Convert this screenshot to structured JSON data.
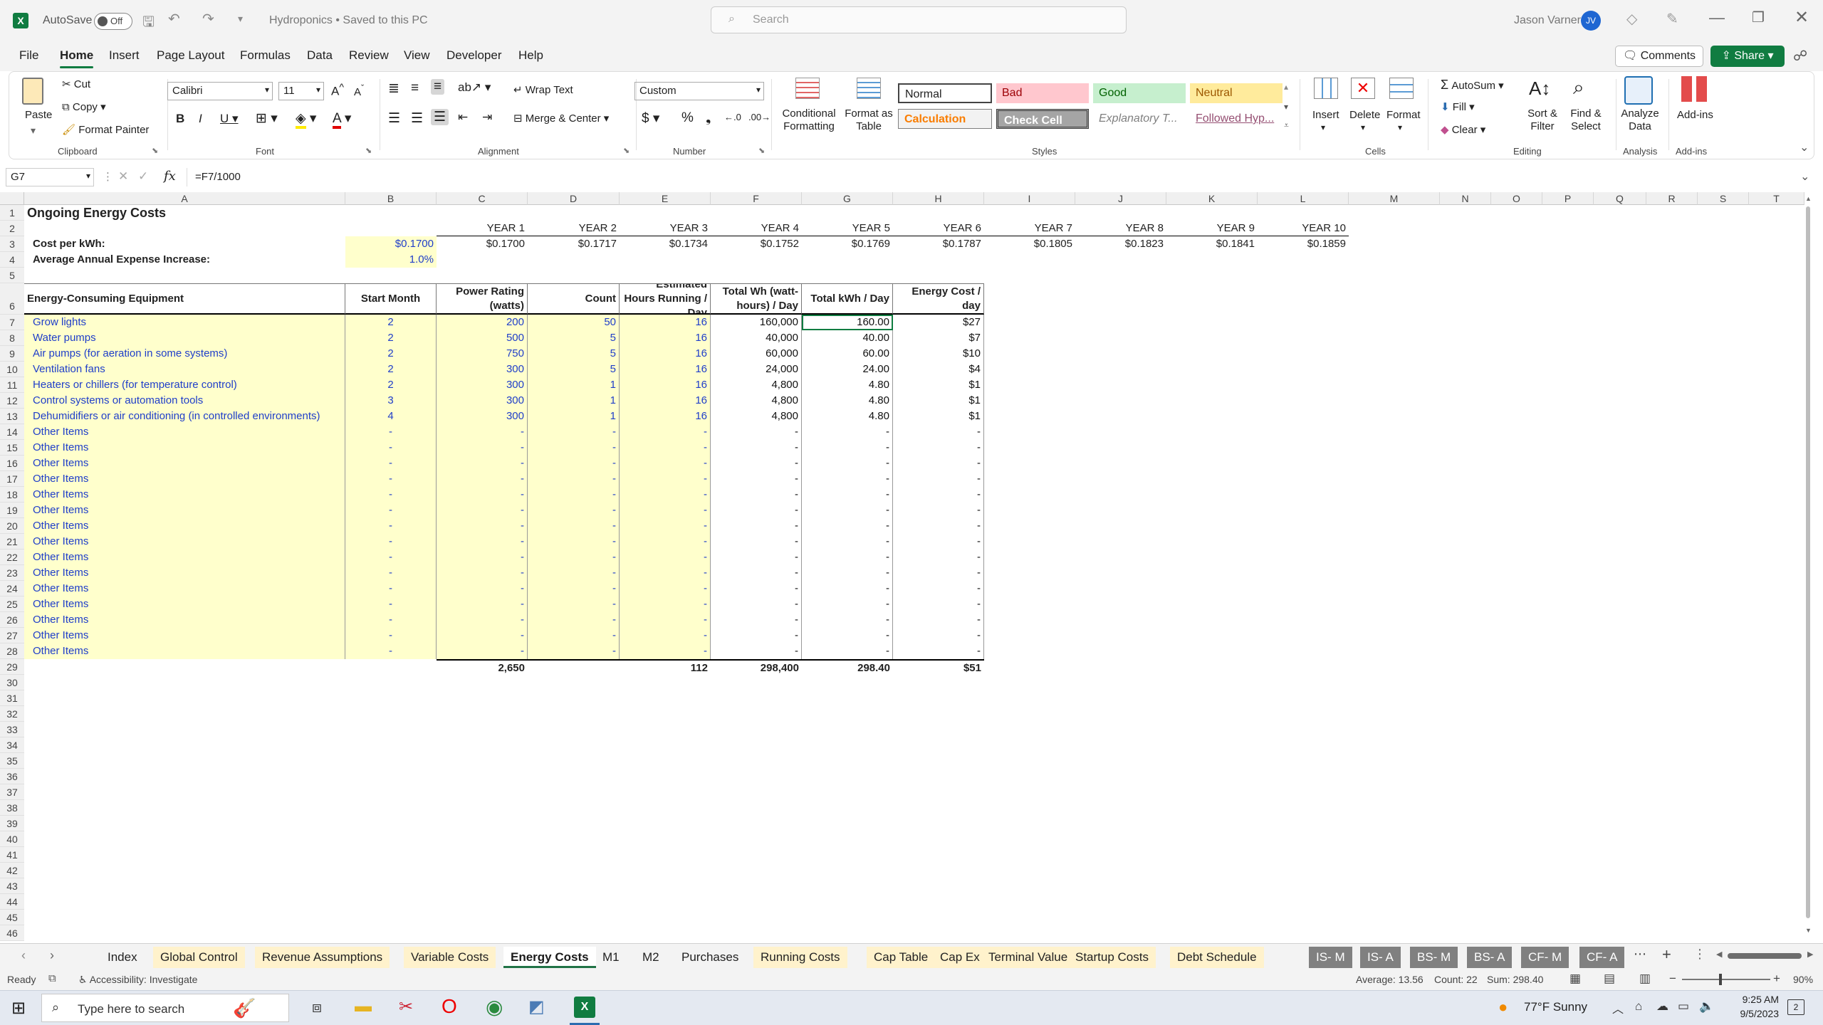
{
  "titlebar": {
    "autosave_label": "AutoSave",
    "autosave_state": "Off",
    "doc_title": "Hydroponics • Saved to this PC",
    "search_placeholder": "Search",
    "user_name": "Jason Varner",
    "user_initials": "JV"
  },
  "ribbon_tabs": [
    "File",
    "Home",
    "Insert",
    "Page Layout",
    "Formulas",
    "Data",
    "Review",
    "View",
    "Developer",
    "Help"
  ],
  "ribbon_right": {
    "comments": "Comments",
    "share": "Share"
  },
  "ribbon": {
    "clipboard": {
      "paste": "Paste",
      "cut": "Cut",
      "copy": "Copy",
      "format_painter": "Format Painter",
      "label": "Clipboard"
    },
    "font": {
      "name": "Calibri",
      "size": "11",
      "label": "Font"
    },
    "alignment": {
      "wrap": "Wrap Text",
      "merge": "Merge & Center",
      "label": "Alignment"
    },
    "number": {
      "format": "Custom",
      "label": "Number"
    },
    "styles": {
      "conditional": "Conditional Formatting",
      "format_table": "Format as Table",
      "normal": "Normal",
      "bad": "Bad",
      "good": "Good",
      "neutral": "Neutral",
      "calculation": "Calculation",
      "check_cell": "Check Cell",
      "explanatory": "Explanatory T...",
      "followed": "Followed Hyp...",
      "label": "Styles"
    },
    "cells": {
      "insert": "Insert",
      "delete": "Delete",
      "format": "Format",
      "label": "Cells"
    },
    "editing": {
      "autosum": "AutoSum",
      "fill": "Fill",
      "clear": "Clear",
      "sort": "Sort & Filter",
      "find": "Find & Select",
      "label": "Editing"
    },
    "analysis": {
      "analyze": "Analyze Data",
      "label": "Analysis"
    },
    "addins": {
      "addins": "Add-ins",
      "label": "Add-ins"
    }
  },
  "formula_bar": {
    "name_box": "G7",
    "formula": "=F7/1000"
  },
  "columns": [
    "A",
    "B",
    "C",
    "D",
    "E",
    "F",
    "G",
    "H",
    "I",
    "J",
    "K",
    "L",
    "M",
    "N",
    "O",
    "P",
    "Q",
    "R",
    "S",
    "T"
  ],
  "sheet": {
    "title": "Ongoing Energy Costs",
    "years": [
      "YEAR 1",
      "YEAR 2",
      "YEAR 3",
      "YEAR 4",
      "YEAR 5",
      "YEAR 6",
      "YEAR 7",
      "YEAR 8",
      "YEAR 9",
      "YEAR 10"
    ],
    "cost_label": "Cost per kWh:",
    "cost_value": "$0.1700",
    "year_costs": [
      "$0.1700",
      "$0.1717",
      "$0.1734",
      "$0.1752",
      "$0.1769",
      "$0.1787",
      "$0.1805",
      "$0.1823",
      "$0.1841",
      "$0.1859"
    ],
    "increase_label": "Average Annual Expense Increase:",
    "increase_value": "1.0%",
    "headers": {
      "equipment": "Energy-Consuming Equipment",
      "start": "Start Month",
      "power": "Power Rating (watts)",
      "count": "Count",
      "hours": "Estimated Hours Running / Day",
      "wh": "Total Wh (watt-hours) / Day",
      "kwh": "Total kWh / Day",
      "cost": "Energy Cost / day"
    },
    "rows": [
      [
        "Grow lights",
        "2",
        "200",
        "50",
        "16",
        "160,000",
        "160.00",
        "$27"
      ],
      [
        "Water pumps",
        "2",
        "500",
        "5",
        "16",
        "40,000",
        "40.00",
        "$7"
      ],
      [
        "Air pumps (for aeration in some systems)",
        "2",
        "750",
        "5",
        "16",
        "60,000",
        "60.00",
        "$10"
      ],
      [
        "Ventilation fans",
        "2",
        "300",
        "5",
        "16",
        "24,000",
        "24.00",
        "$4"
      ],
      [
        "Heaters or chillers (for temperature control)",
        "2",
        "300",
        "1",
        "16",
        "4,800",
        "4.80",
        "$1"
      ],
      [
        "Control systems or automation tools",
        "3",
        "300",
        "1",
        "16",
        "4,800",
        "4.80",
        "$1"
      ],
      [
        "Dehumidifiers or air conditioning (in controlled environments)",
        "4",
        "300",
        "1",
        "16",
        "4,800",
        "4.80",
        "$1"
      ],
      [
        "Other Items",
        "-",
        "-",
        "-",
        "-",
        "-",
        "-",
        "-"
      ],
      [
        "Other Items",
        "-",
        "-",
        "-",
        "-",
        "-",
        "-",
        "-"
      ],
      [
        "Other Items",
        "-",
        "-",
        "-",
        "-",
        "-",
        "-",
        "-"
      ],
      [
        "Other Items",
        "-",
        "-",
        "-",
        "-",
        "-",
        "-",
        "-"
      ],
      [
        "Other Items",
        "-",
        "-",
        "-",
        "-",
        "-",
        "-",
        "-"
      ],
      [
        "Other Items",
        "-",
        "-",
        "-",
        "-",
        "-",
        "-",
        "-"
      ],
      [
        "Other Items",
        "-",
        "-",
        "-",
        "-",
        "-",
        "-",
        "-"
      ],
      [
        "Other Items",
        "-",
        "-",
        "-",
        "-",
        "-",
        "-",
        "-"
      ],
      [
        "Other Items",
        "-",
        "-",
        "-",
        "-",
        "-",
        "-",
        "-"
      ],
      [
        "Other Items",
        "-",
        "-",
        "-",
        "-",
        "-",
        "-",
        "-"
      ],
      [
        "Other Items",
        "-",
        "-",
        "-",
        "-",
        "-",
        "-",
        "-"
      ],
      [
        "Other Items",
        "-",
        "-",
        "-",
        "-",
        "-",
        "-",
        "-"
      ],
      [
        "Other Items",
        "-",
        "-",
        "-",
        "-",
        "-",
        "-",
        "-"
      ],
      [
        "Other Items",
        "-",
        "-",
        "-",
        "-",
        "-",
        "-",
        "-"
      ],
      [
        "Other Items",
        "-",
        "-",
        "-",
        "-",
        "-",
        "-",
        "-"
      ]
    ],
    "totals": {
      "power": "2,650",
      "hours": "112",
      "wh": "298,400",
      "kwh": "298.40",
      "cost": "$51"
    }
  },
  "sheet_tabs": [
    {
      "name": "Index",
      "style": "plain"
    },
    {
      "name": "Global Control",
      "style": "yellow"
    },
    {
      "name": "Revenue Assumptions",
      "style": "yellow"
    },
    {
      "name": "Variable Costs",
      "style": "yellow"
    },
    {
      "name": "Energy Costs",
      "style": "active"
    },
    {
      "name": "M1",
      "style": "plain"
    },
    {
      "name": "M2",
      "style": "plain"
    },
    {
      "name": "Purchases",
      "style": "plain"
    },
    {
      "name": "Running Costs",
      "style": "yellow"
    },
    {
      "name": "Cap Table",
      "style": "yellow"
    },
    {
      "name": "Cap Ex",
      "style": "yellow"
    },
    {
      "name": "Terminal Value",
      "style": "yellow"
    },
    {
      "name": "Startup Costs",
      "style": "yellow"
    },
    {
      "name": "Debt Schedule",
      "style": "yellow"
    },
    {
      "name": "IS- M",
      "style": "gray"
    },
    {
      "name": "IS- A",
      "style": "gray"
    },
    {
      "name": "BS- M",
      "style": "gray"
    },
    {
      "name": "BS- A",
      "style": "gray"
    },
    {
      "name": "CF- M",
      "style": "gray"
    },
    {
      "name": "CF- A",
      "style": "gray"
    }
  ],
  "status": {
    "ready": "Ready",
    "accessibility": "Accessibility: Investigate",
    "average": "Average: 13.56",
    "count": "Count: 22",
    "sum": "Sum: 298.40",
    "zoom": "90%"
  },
  "taskbar": {
    "search_placeholder": "Type here to search",
    "weather": "77°F  Sunny",
    "time": "9:25 AM",
    "date": "9/5/2023",
    "notifications": "2"
  }
}
